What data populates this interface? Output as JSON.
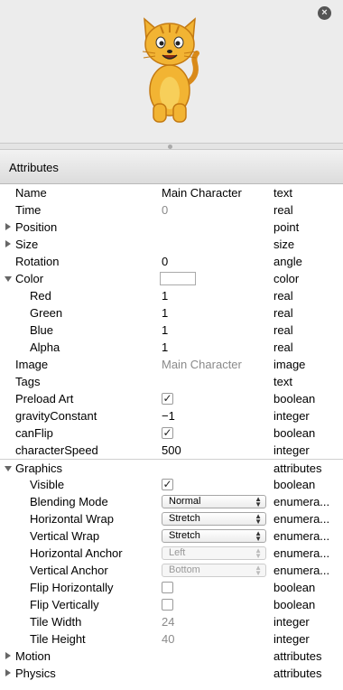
{
  "panel": {
    "close_icon": "×",
    "title": "Attributes"
  },
  "rows": {
    "name": {
      "label": "Name",
      "value": "Main Character",
      "type": "text"
    },
    "time": {
      "label": "Time",
      "value": "0",
      "type": "real"
    },
    "position": {
      "label": "Position",
      "type": "point"
    },
    "size": {
      "label": "Size",
      "type": "size"
    },
    "rotation": {
      "label": "Rotation",
      "value": "0",
      "type": "angle"
    },
    "color": {
      "label": "Color",
      "type": "color",
      "swatch": "#ffffff"
    },
    "red": {
      "label": "Red",
      "value": "1",
      "type": "real"
    },
    "green": {
      "label": "Green",
      "value": "1",
      "type": "real"
    },
    "blue": {
      "label": "Blue",
      "value": "1",
      "type": "real"
    },
    "alpha": {
      "label": "Alpha",
      "value": "1",
      "type": "real"
    },
    "image": {
      "label": "Image",
      "value": "Main Character",
      "type": "image"
    },
    "tags": {
      "label": "Tags",
      "type": "text"
    },
    "preload_art": {
      "label": "Preload Art",
      "checked": true,
      "type": "boolean"
    },
    "gravity_constant": {
      "label": "gravityConstant",
      "value": "−1",
      "type": "integer"
    },
    "can_flip": {
      "label": "canFlip",
      "checked": true,
      "type": "boolean"
    },
    "character_speed": {
      "label": "characterSpeed",
      "value": "500",
      "type": "integer"
    },
    "graphics": {
      "label": "Graphics",
      "type": "attributes"
    },
    "visible": {
      "label": "Visible",
      "checked": true,
      "type": "boolean"
    },
    "blending_mode": {
      "label": "Blending Mode",
      "value": "Normal",
      "type": "enumera..."
    },
    "horizontal_wrap": {
      "label": "Horizontal Wrap",
      "value": "Stretch",
      "type": "enumera..."
    },
    "vertical_wrap": {
      "label": "Vertical Wrap",
      "value": "Stretch",
      "type": "enumera..."
    },
    "horizontal_anchor": {
      "label": "Horizontal Anchor",
      "value": "Left",
      "type": "enumera..."
    },
    "vertical_anchor": {
      "label": "Vertical Anchor",
      "value": "Bottom",
      "type": "enumera..."
    },
    "flip_horizontally": {
      "label": "Flip Horizontally",
      "checked": false,
      "type": "boolean"
    },
    "flip_vertically": {
      "label": "Flip Vertically",
      "checked": false,
      "type": "boolean"
    },
    "tile_width": {
      "label": "Tile Width",
      "value": "24",
      "type": "integer"
    },
    "tile_height": {
      "label": "Tile Height",
      "value": "40",
      "type": "integer"
    },
    "motion": {
      "label": "Motion",
      "type": "attributes"
    },
    "physics": {
      "label": "Physics",
      "type": "attributes"
    }
  },
  "icons": {
    "checkmark": "✓",
    "select_arrows_up": "▲",
    "select_arrows_down": "▼"
  }
}
